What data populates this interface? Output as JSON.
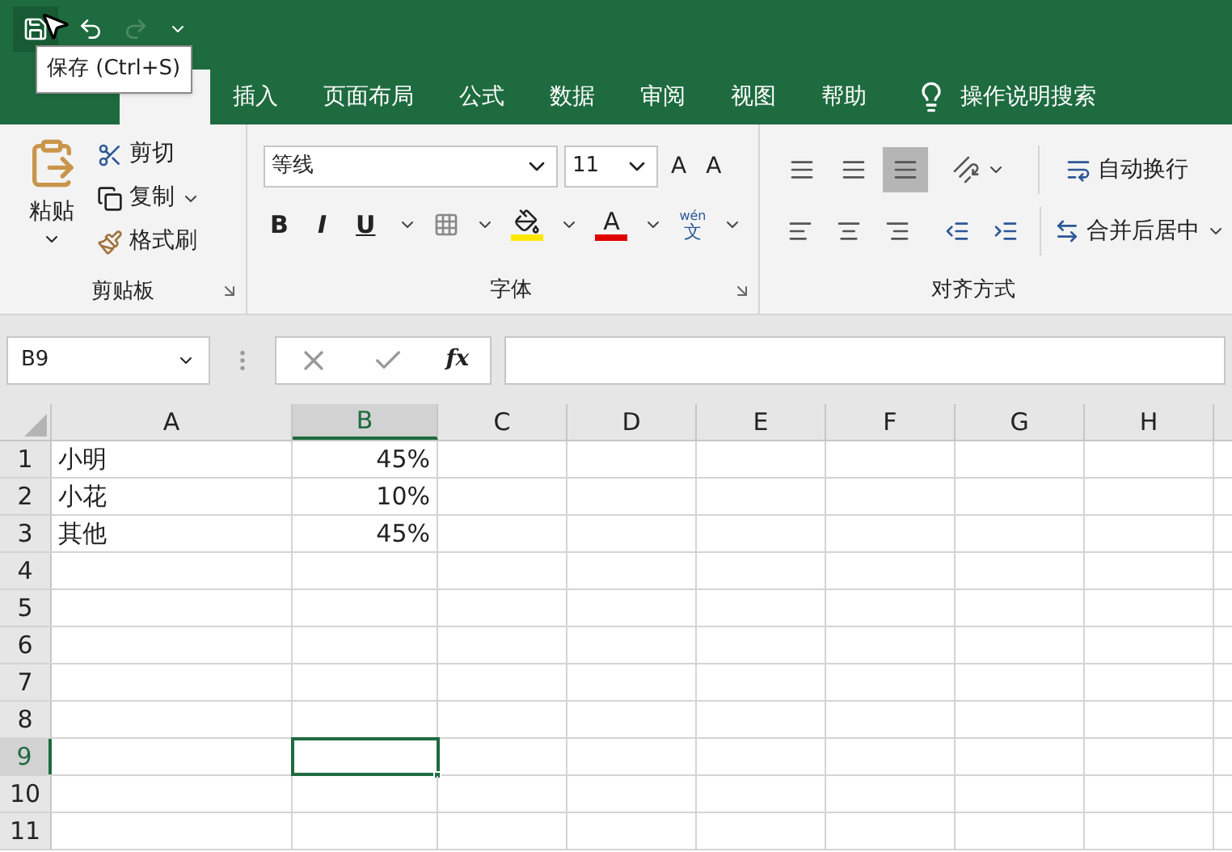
{
  "quick_access": {
    "redo_disabled": true
  },
  "tooltip": "保存 (Ctrl+S)",
  "tabs": [
    {
      "selected": false
    },
    {
      "selected": true
    },
    {
      "label": "插入",
      "selected": false
    },
    {
      "label": "页面布局",
      "selected": false
    },
    {
      "label": "公式",
      "selected": false
    },
    {
      "label": "数据",
      "selected": false
    },
    {
      "label": "审阅",
      "selected": false
    },
    {
      "label": "视图",
      "selected": false
    },
    {
      "label": "帮助",
      "selected": false
    }
  ],
  "tell_me": "操作说明搜索",
  "clipboard": {
    "paste": "粘贴",
    "cut": "剪切",
    "copy": "复制",
    "format_painter": "格式刷",
    "group_label": "剪贴板"
  },
  "font": {
    "name": "等线",
    "size": "11",
    "grow": "A",
    "shrink": "A",
    "bold": "B",
    "italic": "I",
    "underline": "U",
    "font_color": "A",
    "phonetic_top": "wén",
    "phonetic_bottom": "文",
    "group_label": "字体"
  },
  "alignment": {
    "vertical": [
      {
        "selected": false
      },
      {
        "selected": false
      },
      {
        "selected": true
      }
    ],
    "wrap": "自动换行",
    "merge": "合并后居中",
    "group_label": "对齐方式"
  },
  "name_box": "B9",
  "fx": "fx",
  "grid": {
    "columns": [
      {
        "label": "A",
        "selected": false
      },
      {
        "label": "B",
        "selected": true
      },
      {
        "label": "C",
        "selected": false
      },
      {
        "label": "D",
        "selected": false
      },
      {
        "label": "E",
        "selected": false
      },
      {
        "label": "F",
        "selected": false
      },
      {
        "label": "G",
        "selected": false
      },
      {
        "label": "H",
        "selected": false
      }
    ],
    "rows": [
      {
        "label": "1",
        "selected": false,
        "cells": [
          "小明",
          "45%"
        ]
      },
      {
        "label": "2",
        "selected": false,
        "cells": [
          "小花",
          "10%"
        ]
      },
      {
        "label": "3",
        "selected": false,
        "cells": [
          "其他",
          "45%"
        ]
      },
      {
        "label": "4",
        "selected": false
      },
      {
        "label": "5",
        "selected": false
      },
      {
        "label": "6",
        "selected": false
      },
      {
        "label": "7",
        "selected": false
      },
      {
        "label": "8",
        "selected": false
      },
      {
        "label": "9",
        "selected": true
      },
      {
        "label": "10",
        "selected": false
      },
      {
        "label": "11",
        "selected": false
      }
    ]
  }
}
